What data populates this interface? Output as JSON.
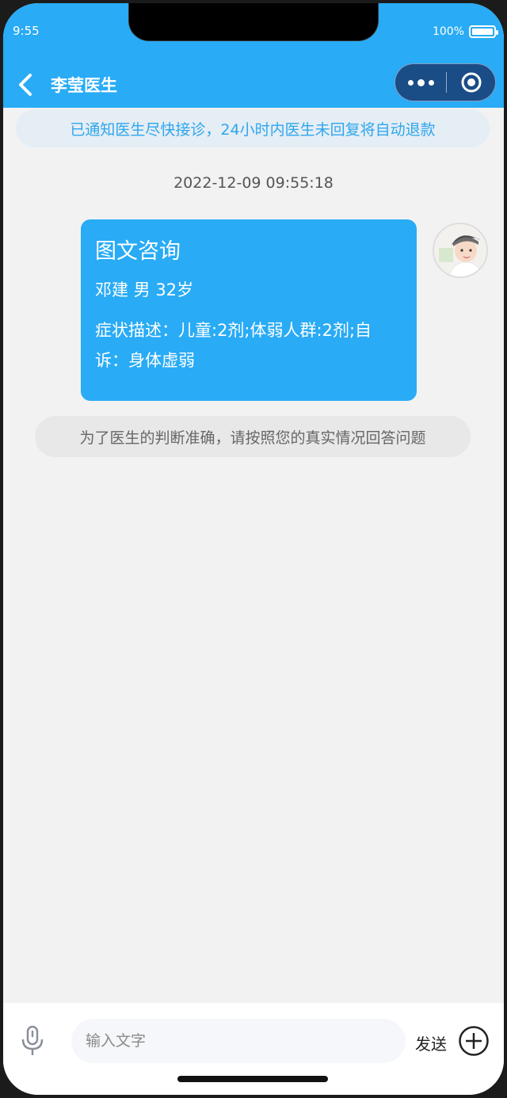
{
  "status_bar": {
    "time": "9:55",
    "battery": "100%",
    "battery_level": 1.0
  },
  "nav": {
    "title": "李莹医生"
  },
  "notice": "已通知医生尽快接诊，24小时内医生未回复将自动退款",
  "timestamp": "2022-12-09 09:55:18",
  "message": {
    "title": "图文咨询",
    "patient": "邓建 男 32岁",
    "description": "症状描述：儿童:2剂;体弱人群:2剂;自诉：身体虚弱"
  },
  "tip": "为了医生的判断准确，请按照您的真实情况回答问题",
  "input": {
    "placeholder": "输入文字"
  },
  "send_label": "发送",
  "colors": {
    "primary": "#29abf5",
    "capsule": "#1a4c86",
    "background": "#f2f2f2"
  }
}
